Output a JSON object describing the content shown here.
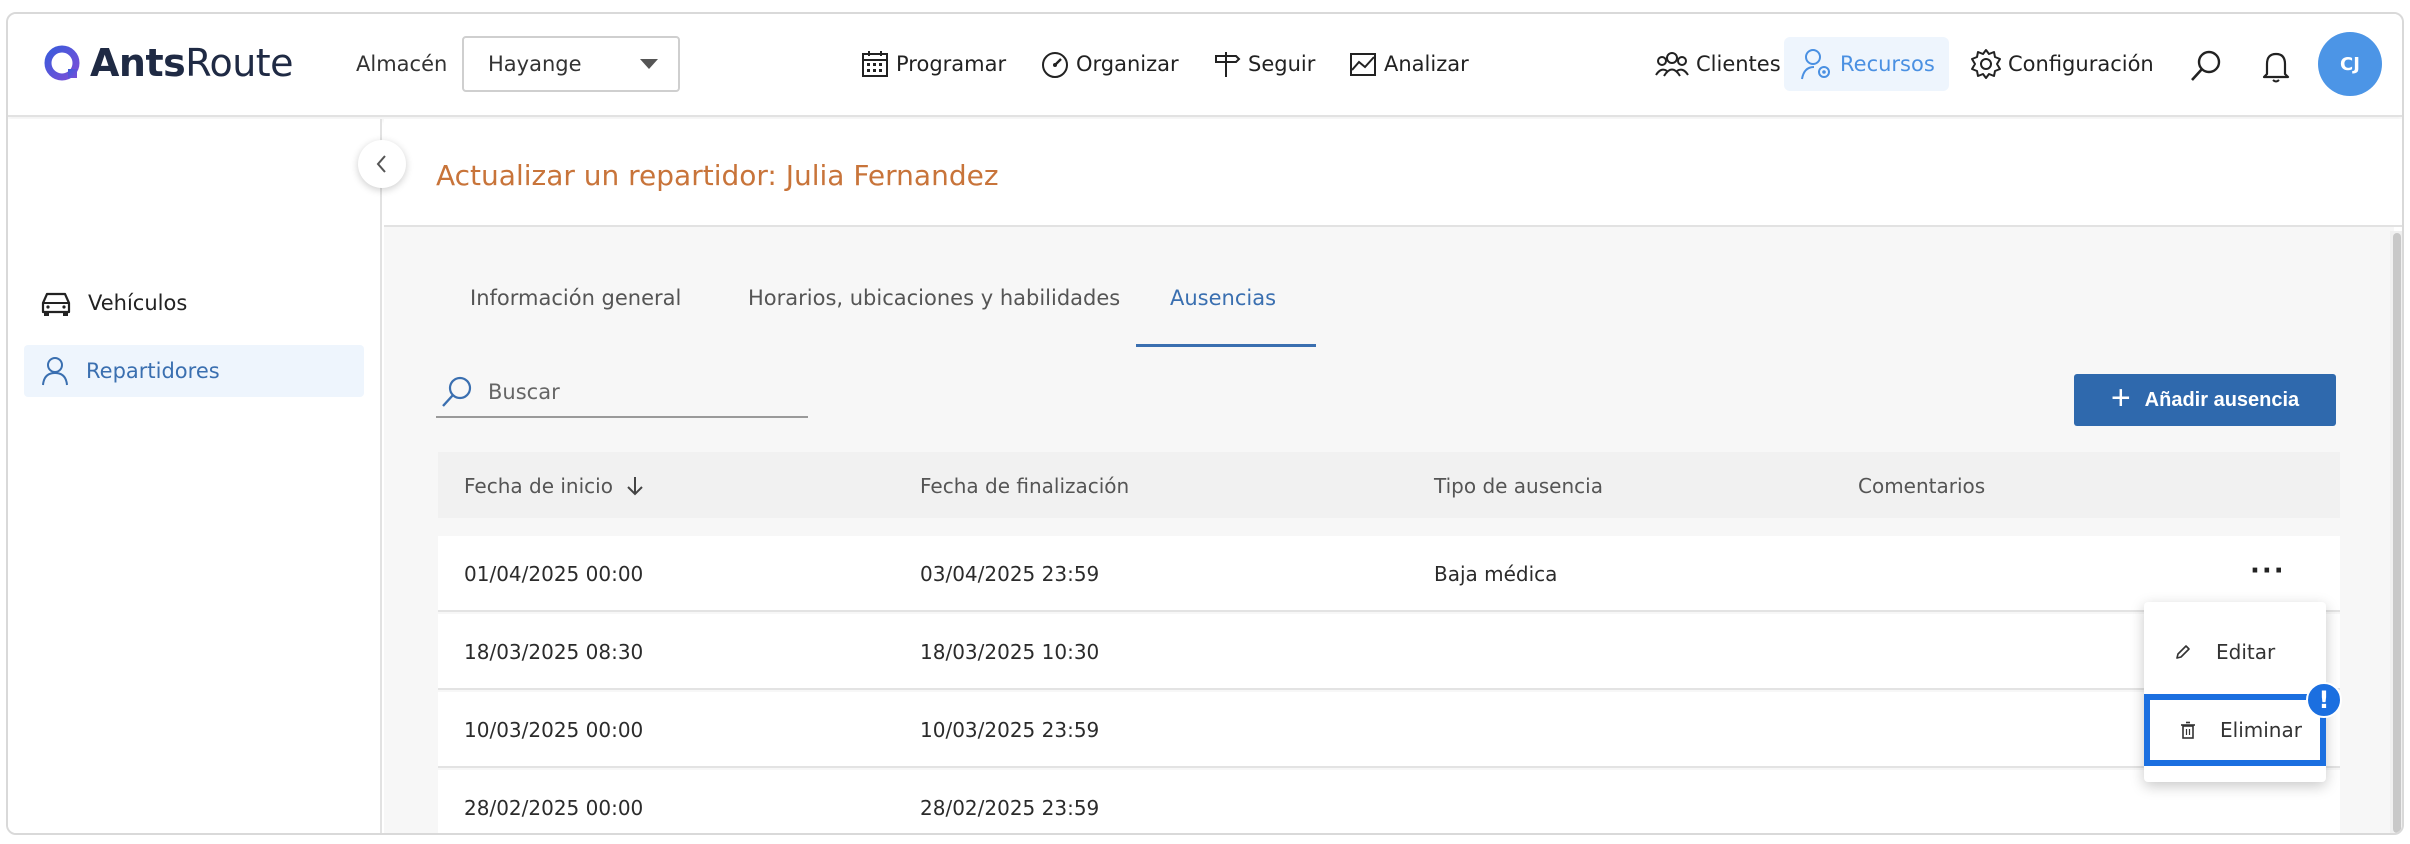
{
  "app": {
    "brand_bold": "Ants",
    "brand_light": "Route"
  },
  "header": {
    "warehouse_label": "Almacén",
    "warehouse_value": "Hayange",
    "nav": {
      "programar": "Programar",
      "organizar": "Organizar",
      "seguir": "Seguir",
      "analizar": "Analizar",
      "clientes": "Clientes",
      "recursos": "Recursos",
      "configuracion": "Configuración"
    },
    "avatar_initials": "CJ"
  },
  "sidebar": {
    "items": [
      {
        "label": "Vehículos",
        "icon": "car-icon"
      },
      {
        "label": "Repartidores",
        "icon": "user-icon"
      }
    ]
  },
  "page": {
    "title": "Actualizar un repartidor: Julia Fernandez"
  },
  "tabs": [
    {
      "label": "Información general"
    },
    {
      "label": "Horarios, ubicaciones y habilidades"
    },
    {
      "label": "Ausencias"
    }
  ],
  "search": {
    "placeholder": "Buscar"
  },
  "toolbar": {
    "add_label": "Añadir ausencia"
  },
  "table": {
    "columns": [
      "Fecha de inicio",
      "Fecha de finalización",
      "Tipo de ausencia",
      "Comentarios"
    ],
    "rows": [
      {
        "start": "01/04/2025 00:00",
        "end": "03/04/2025 23:59",
        "type": "Baja médica",
        "comments": ""
      },
      {
        "start": "18/03/2025 08:30",
        "end": "18/03/2025 10:30",
        "type": "",
        "comments": ""
      },
      {
        "start": "10/03/2025 00:00",
        "end": "10/03/2025 23:59",
        "type": "",
        "comments": ""
      },
      {
        "start": "28/02/2025 00:00",
        "end": "28/02/2025 23:59",
        "type": "",
        "comments": ""
      }
    ]
  },
  "context_menu": {
    "edit": "Editar",
    "delete": "Eliminar",
    "badge": "!"
  },
  "colors": {
    "accent": "#2f69ad",
    "title": "#c8743a",
    "highlight": "#1b6fe0",
    "avatar": "#4c95e6"
  }
}
